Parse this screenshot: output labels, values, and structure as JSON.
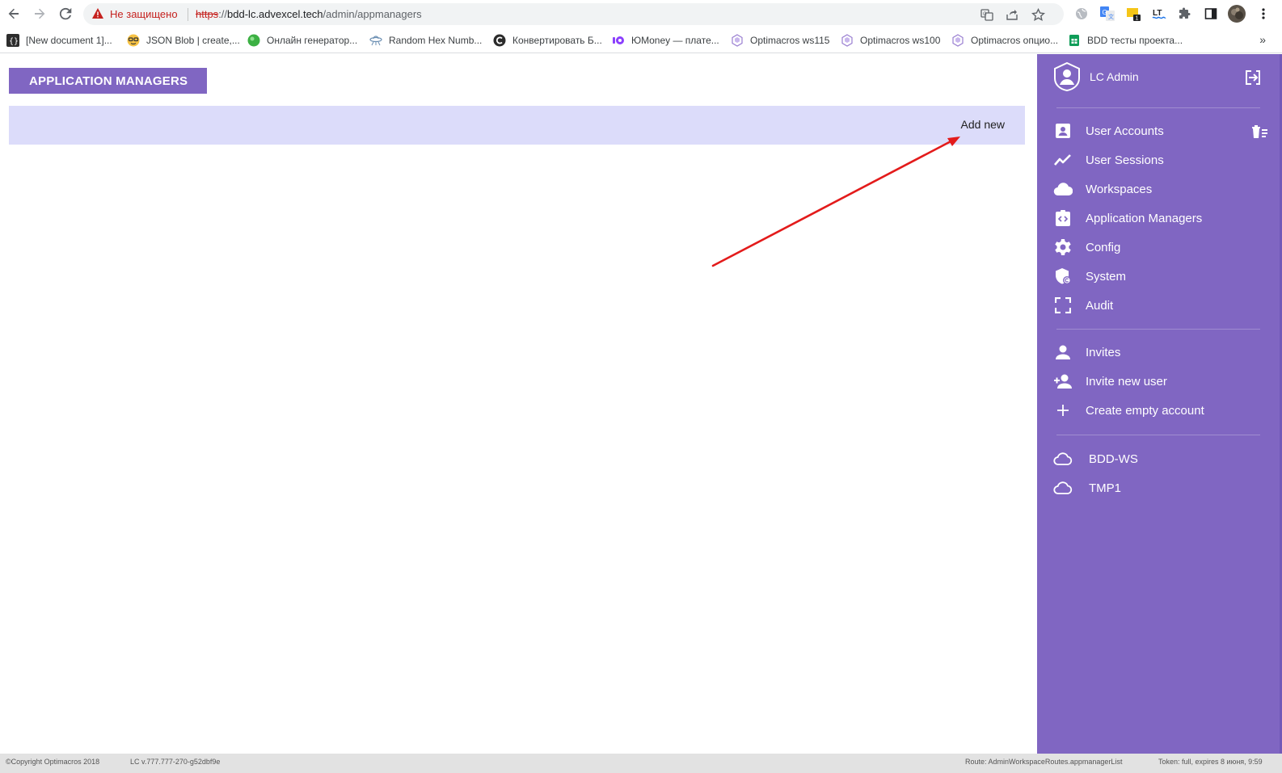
{
  "browser": {
    "security_label": "Не защищено",
    "url_scheme": "https",
    "url_sep": "://",
    "url_host": "bdd-lc.advexcel.tech",
    "url_path": "/admin/appmanagers",
    "bookmarks": [
      {
        "label": "[New document 1]...",
        "icon": "braces-icon"
      },
      {
        "label": "JSON Blob | create,...",
        "icon": "nerd-face-icon"
      },
      {
        "label": "Онлайн генератор...",
        "icon": "green-circle-icon"
      },
      {
        "label": "Random Hex Numb...",
        "icon": "ufo-icon"
      },
      {
        "label": "Конвертировать Б...",
        "icon": "c-logo-icon"
      },
      {
        "label": "ЮMoney — плате...",
        "icon": "yoomoney-icon"
      },
      {
        "label": "Optimacros ws115",
        "icon": "optimacros-icon"
      },
      {
        "label": "Optimacros ws100",
        "icon": "optimacros-icon"
      },
      {
        "label": "Optimacros опцио...",
        "icon": "optimacros-icon"
      },
      {
        "label": "BDD тесты проекта...",
        "icon": "sheets-icon"
      }
    ],
    "more_label": "»"
  },
  "page": {
    "title": "APPLICATION MANAGERS",
    "add_new_label": "Add new"
  },
  "sidebar": {
    "user_name": "LC Admin",
    "menu": [
      {
        "label": "User Accounts",
        "icon": "account-box-icon"
      },
      {
        "label": "User Sessions",
        "icon": "trending-icon"
      },
      {
        "label": "Workspaces",
        "icon": "cloud-icon"
      },
      {
        "label": "Application Managers",
        "icon": "app-code-icon"
      },
      {
        "label": "Config",
        "icon": "gear-icon"
      },
      {
        "label": "System",
        "icon": "shield-icon"
      },
      {
        "label": "Audit",
        "icon": "fullscreen-icon"
      }
    ],
    "invites_menu": [
      {
        "label": "Invites",
        "icon": "person-icon"
      },
      {
        "label": "Invite new user",
        "icon": "person-add-icon"
      },
      {
        "label": "Create empty account",
        "icon": "plus-icon"
      }
    ],
    "workspaces": [
      {
        "label": "BDD-WS",
        "icon": "cloud-outline-icon"
      },
      {
        "label": "TMP1",
        "icon": "cloud-outline-icon"
      }
    ],
    "accent_color": "#8066c2"
  },
  "statusbar": {
    "copyright": "©Copyright Optimacros 2018",
    "version": "LC v.777.777-270-g52dbf9e",
    "route": "Route: AdminWorkspaceRoutes.appmanagerList",
    "token": "Token: full, expires 8 июня, 9:59"
  }
}
